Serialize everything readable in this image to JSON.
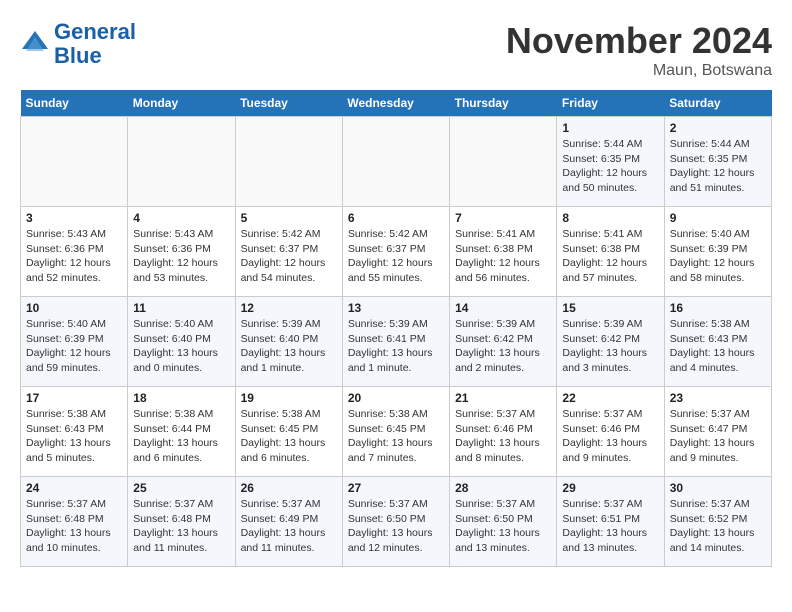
{
  "header": {
    "logo_line1": "General",
    "logo_line2": "Blue",
    "month": "November 2024",
    "location": "Maun, Botswana"
  },
  "weekdays": [
    "Sunday",
    "Monday",
    "Tuesday",
    "Wednesday",
    "Thursday",
    "Friday",
    "Saturday"
  ],
  "weeks": [
    [
      {
        "day": "",
        "info": ""
      },
      {
        "day": "",
        "info": ""
      },
      {
        "day": "",
        "info": ""
      },
      {
        "day": "",
        "info": ""
      },
      {
        "day": "",
        "info": ""
      },
      {
        "day": "1",
        "info": "Sunrise: 5:44 AM\nSunset: 6:35 PM\nDaylight: 12 hours\nand 50 minutes."
      },
      {
        "day": "2",
        "info": "Sunrise: 5:44 AM\nSunset: 6:35 PM\nDaylight: 12 hours\nand 51 minutes."
      }
    ],
    [
      {
        "day": "3",
        "info": "Sunrise: 5:43 AM\nSunset: 6:36 PM\nDaylight: 12 hours\nand 52 minutes."
      },
      {
        "day": "4",
        "info": "Sunrise: 5:43 AM\nSunset: 6:36 PM\nDaylight: 12 hours\nand 53 minutes."
      },
      {
        "day": "5",
        "info": "Sunrise: 5:42 AM\nSunset: 6:37 PM\nDaylight: 12 hours\nand 54 minutes."
      },
      {
        "day": "6",
        "info": "Sunrise: 5:42 AM\nSunset: 6:37 PM\nDaylight: 12 hours\nand 55 minutes."
      },
      {
        "day": "7",
        "info": "Sunrise: 5:41 AM\nSunset: 6:38 PM\nDaylight: 12 hours\nand 56 minutes."
      },
      {
        "day": "8",
        "info": "Sunrise: 5:41 AM\nSunset: 6:38 PM\nDaylight: 12 hours\nand 57 minutes."
      },
      {
        "day": "9",
        "info": "Sunrise: 5:40 AM\nSunset: 6:39 PM\nDaylight: 12 hours\nand 58 minutes."
      }
    ],
    [
      {
        "day": "10",
        "info": "Sunrise: 5:40 AM\nSunset: 6:39 PM\nDaylight: 12 hours\nand 59 minutes."
      },
      {
        "day": "11",
        "info": "Sunrise: 5:40 AM\nSunset: 6:40 PM\nDaylight: 13 hours\nand 0 minutes."
      },
      {
        "day": "12",
        "info": "Sunrise: 5:39 AM\nSunset: 6:40 PM\nDaylight: 13 hours\nand 1 minute."
      },
      {
        "day": "13",
        "info": "Sunrise: 5:39 AM\nSunset: 6:41 PM\nDaylight: 13 hours\nand 1 minute."
      },
      {
        "day": "14",
        "info": "Sunrise: 5:39 AM\nSunset: 6:42 PM\nDaylight: 13 hours\nand 2 minutes."
      },
      {
        "day": "15",
        "info": "Sunrise: 5:39 AM\nSunset: 6:42 PM\nDaylight: 13 hours\nand 3 minutes."
      },
      {
        "day": "16",
        "info": "Sunrise: 5:38 AM\nSunset: 6:43 PM\nDaylight: 13 hours\nand 4 minutes."
      }
    ],
    [
      {
        "day": "17",
        "info": "Sunrise: 5:38 AM\nSunset: 6:43 PM\nDaylight: 13 hours\nand 5 minutes."
      },
      {
        "day": "18",
        "info": "Sunrise: 5:38 AM\nSunset: 6:44 PM\nDaylight: 13 hours\nand 6 minutes."
      },
      {
        "day": "19",
        "info": "Sunrise: 5:38 AM\nSunset: 6:45 PM\nDaylight: 13 hours\nand 6 minutes."
      },
      {
        "day": "20",
        "info": "Sunrise: 5:38 AM\nSunset: 6:45 PM\nDaylight: 13 hours\nand 7 minutes."
      },
      {
        "day": "21",
        "info": "Sunrise: 5:37 AM\nSunset: 6:46 PM\nDaylight: 13 hours\nand 8 minutes."
      },
      {
        "day": "22",
        "info": "Sunrise: 5:37 AM\nSunset: 6:46 PM\nDaylight: 13 hours\nand 9 minutes."
      },
      {
        "day": "23",
        "info": "Sunrise: 5:37 AM\nSunset: 6:47 PM\nDaylight: 13 hours\nand 9 minutes."
      }
    ],
    [
      {
        "day": "24",
        "info": "Sunrise: 5:37 AM\nSunset: 6:48 PM\nDaylight: 13 hours\nand 10 minutes."
      },
      {
        "day": "25",
        "info": "Sunrise: 5:37 AM\nSunset: 6:48 PM\nDaylight: 13 hours\nand 11 minutes."
      },
      {
        "day": "26",
        "info": "Sunrise: 5:37 AM\nSunset: 6:49 PM\nDaylight: 13 hours\nand 11 minutes."
      },
      {
        "day": "27",
        "info": "Sunrise: 5:37 AM\nSunset: 6:50 PM\nDaylight: 13 hours\nand 12 minutes."
      },
      {
        "day": "28",
        "info": "Sunrise: 5:37 AM\nSunset: 6:50 PM\nDaylight: 13 hours\nand 13 minutes."
      },
      {
        "day": "29",
        "info": "Sunrise: 5:37 AM\nSunset: 6:51 PM\nDaylight: 13 hours\nand 13 minutes."
      },
      {
        "day": "30",
        "info": "Sunrise: 5:37 AM\nSunset: 6:52 PM\nDaylight: 13 hours\nand 14 minutes."
      }
    ]
  ]
}
